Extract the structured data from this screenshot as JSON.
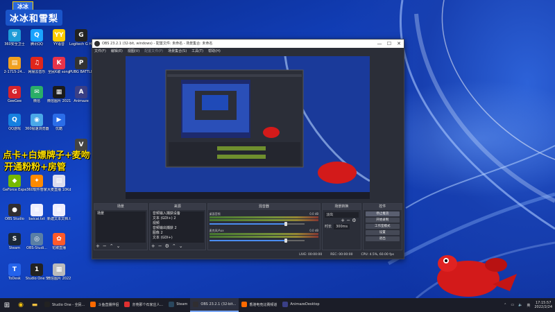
{
  "desktop": {
    "logo_tag": "冰冰",
    "logo_name": "冰冰和雪梨",
    "overlay_line1": "点卡+白嫖牌子+麦吻",
    "overlay_line2": "开通粉粉+房管",
    "icons": [
      {
        "label": "360安全卫士",
        "color": "#1e9bd7",
        "glyph": "⛨"
      },
      {
        "label": "腾讯QQ",
        "color": "#1aa3ff",
        "glyph": "Q"
      },
      {
        "label": "YY语音",
        "color": "#ffcc00",
        "glyph": "YY"
      },
      {
        "label": "Logitech G HUB",
        "color": "#222",
        "glyph": "G"
      },
      {
        "label": "2-1715-24...",
        "color": "#f0a020",
        "glyph": "▤"
      },
      {
        "label": "网易云音乐",
        "color": "#e0261b",
        "glyph": "♫"
      },
      {
        "label": "全民K歌 song",
        "color": "#e8334a",
        "glyph": "K"
      },
      {
        "label": "PUBG BATTLEG...",
        "color": "#333",
        "glyph": "P"
      },
      {
        "label": "GeeGee",
        "color": "#d6242c",
        "glyph": "G"
      },
      {
        "label": "微信",
        "color": "#2aae67",
        "glyph": "✉"
      },
      {
        "label": "微信图片 20211222...",
        "color": "#1b1b1b",
        "glyph": "▦"
      },
      {
        "label": "Animaze",
        "color": "#3a3f86",
        "glyph": "A"
      },
      {
        "label": "QQ游戏",
        "color": "#1680e0",
        "glyph": "Q"
      },
      {
        "label": "360极速浏览器",
        "color": "#4aa8e8",
        "glyph": "◉"
      },
      {
        "label": "优酷",
        "color": "#2b6de8",
        "glyph": "▶"
      },
      {
        "label": "腾讯Volume",
        "color": "#444",
        "glyph": "V"
      },
      {
        "label": "GeForce Experience",
        "color": "#76b900",
        "glyph": "◆"
      },
      {
        "label": "360软件管家",
        "color": "#ff8a00",
        "glyph": "✦"
      },
      {
        "label": "大麦直播 10Kdata...",
        "color": "#dde",
        "glyph": "▤"
      },
      {
        "label": "OBS Studio",
        "color": "#302e31",
        "glyph": "●"
      },
      {
        "label": "baicai.txt",
        "color": "#eef",
        "glyph": "≡"
      },
      {
        "label": "新建文本文档.txt",
        "color": "#eef",
        "glyph": "≡"
      },
      {
        "label": "Steam",
        "color": "#1b2838",
        "glyph": "S"
      },
      {
        "label": "OBS-Studi...",
        "color": "#5a7fa5",
        "glyph": "◎"
      },
      {
        "label": "花椒直播",
        "color": "#ff5a2a",
        "glyph": "✿"
      },
      {
        "label": "ToDesk",
        "color": "#2463eb",
        "glyph": "T"
      },
      {
        "label": "Studio One 5",
        "color": "#222",
        "glyph": "1"
      },
      {
        "label": "微信图片 2022022...",
        "color": "#bbb",
        "glyph": "▦"
      }
    ]
  },
  "obs": {
    "title": "OBS 23.2.1 (32-bit, windows) - 配置文件: 未命名 - 场景集合: 未命名",
    "menu": [
      "文件(F)",
      "编辑(E)",
      "视图(V)",
      "配置文件(P)",
      "场景集合(S)",
      "工具(T)",
      "帮助(H)"
    ],
    "docks": {
      "scenes": {
        "title": "场景",
        "items": [
          "场景"
        ]
      },
      "sources": {
        "title": "来源",
        "items": [
          "音频输入捕获设备",
          "文本 (GDI+) 2",
          "视频",
          "音频输出捕获 2",
          "图像 2",
          "文本 (GDI+)"
        ]
      },
      "mixer": {
        "title": "混音器",
        "channels": [
          {
            "name": "桌面音频",
            "level": "0.0 dB",
            "volume": 0.8
          },
          {
            "name": "麦克风/Aux",
            "level": "0.0 dB",
            "volume": 0.8
          }
        ]
      },
      "transitions": {
        "title": "场景转换",
        "type": "淡出",
        "duration_label": "时长",
        "duration_value": "300ms"
      },
      "controls": {
        "title": "控件",
        "buttons": [
          "停止推流",
          "开始录制",
          "工作室模式",
          "设置",
          "退出"
        ]
      }
    },
    "status": {
      "live": "LIVE: 00:00:00",
      "rec": "REC: 00:00:00",
      "cpu": "CPU: 4.5%, 60.00 fps"
    }
  },
  "taskbar": {
    "apps": [
      {
        "label": "Studio One - 全民...",
        "color": "#222",
        "active": false
      },
      {
        "label": "斗鱼直播伴侣",
        "color": "#ff6a00",
        "active": false
      },
      {
        "label": "亦苑那个石家庄人...",
        "color": "#e03030",
        "active": false
      },
      {
        "label": "Steam",
        "color": "#2a475e",
        "active": false
      },
      {
        "label": "OBS 23.2.1 (32-bit...",
        "color": "#302e31",
        "active": true
      },
      {
        "label": "香港电竞比赛频道",
        "color": "#ff6a00",
        "active": false
      },
      {
        "label": "AnimazeDesktop",
        "color": "#3a3f86",
        "active": false
      }
    ],
    "time": "17:15:57",
    "date": "2022/2/24",
    "lang": "英"
  }
}
